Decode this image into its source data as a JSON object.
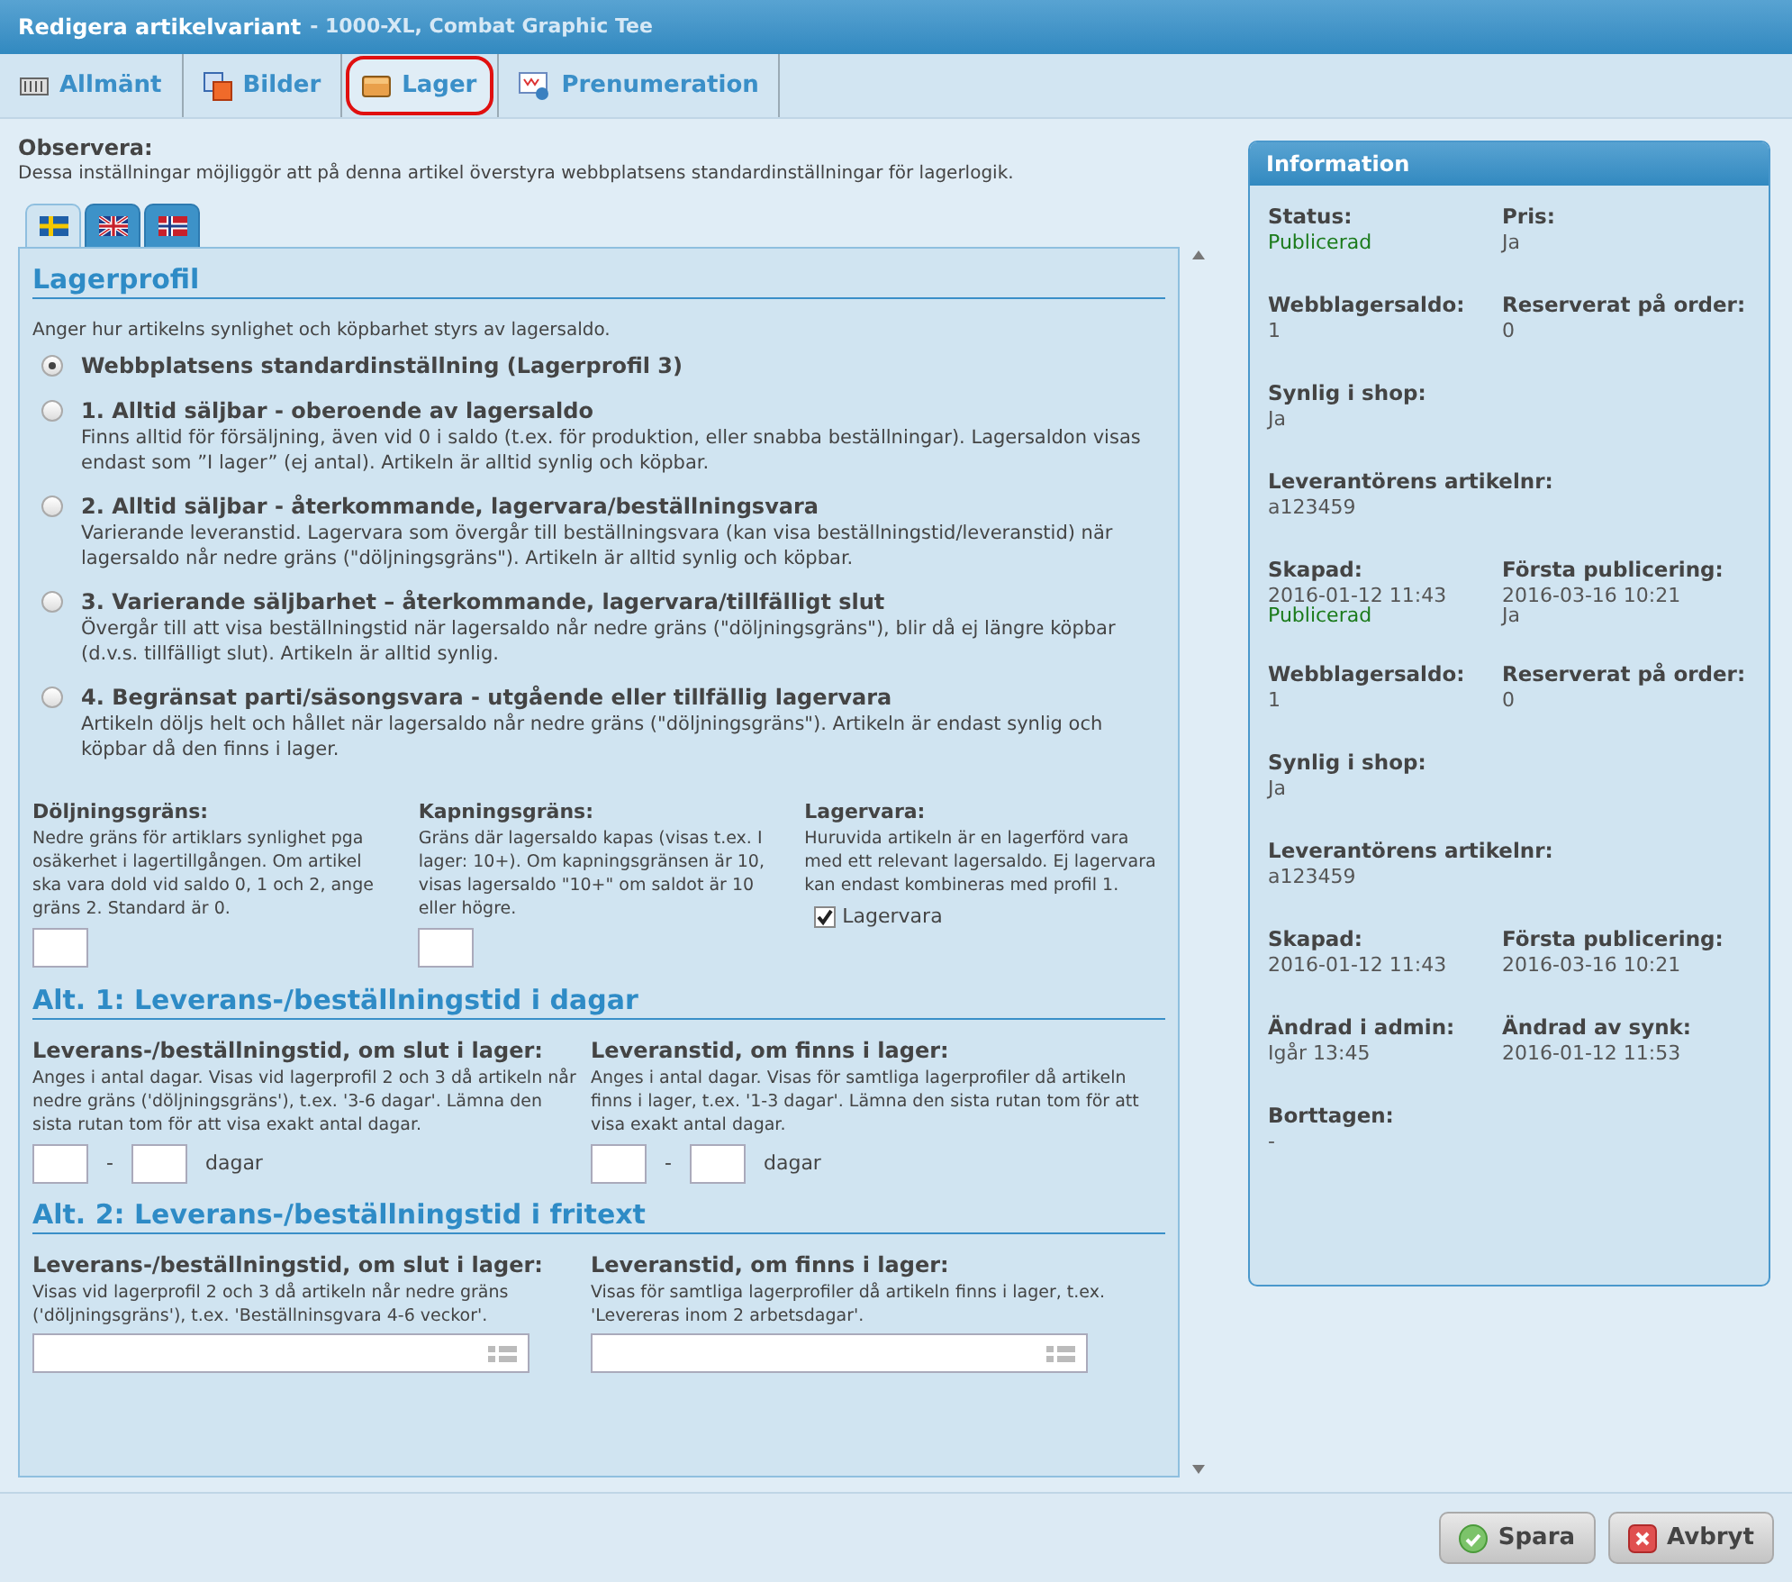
{
  "window": {
    "title": "Redigera artikelvariant",
    "subtitle": "- 1000-XL, Combat Graphic Tee"
  },
  "tabs": [
    {
      "label": "Allmänt",
      "kind": "sliders",
      "selected": false
    },
    {
      "label": "Bilder",
      "kind": "images",
      "selected": false
    },
    {
      "label": "Lager",
      "kind": "box",
      "selected": true
    },
    {
      "label": "Prenumeration",
      "kind": "subscription",
      "selected": false
    }
  ],
  "notice": {
    "title": "Observera:",
    "text": "Dessa inställningar möjliggör att på denna artikel överstyra webbplatsens standardinställningar för lagerlogik."
  },
  "language_tabs": [
    {
      "kind": "sweden",
      "selected": true
    },
    {
      "kind": "uk",
      "selected": false
    },
    {
      "kind": "norway",
      "selected": false
    }
  ],
  "profile": {
    "heading": "Lagerprofil",
    "intro": "Anger hur artikelns synlighet och köpbarhet styrs av lagersaldo.",
    "options": [
      {
        "title": "Webbplatsens standardinställning (Lagerprofil 3)",
        "selected": true
      },
      {
        "title": "1. Alltid säljbar - oberoende av lagersaldo",
        "description": "Finns alltid för försäljning, även vid 0 i saldo (t.ex. för produktion, eller snabba beställningar). Lagersaldon visas endast som ”I lager” (ej antal). Artikeln är alltid synlig och köpbar.",
        "selected": false
      },
      {
        "title": "2. Alltid säljbar - återkommande, lagervara/beställningsvara",
        "description": "Varierande leveranstid. Lagervara som övergår till beställningsvara (kan visa beställningstid/leveranstid) när lagersaldo når nedre gräns (\"döljningsgräns\"). Artikeln är alltid synlig och köpbar.",
        "selected": false
      },
      {
        "title": "3. Varierande säljbarhet – återkommande, lagervara/tillfälligt slut",
        "description": "Övergår till att visa beställningstid när lagersaldo når nedre gräns (\"döljningsgräns\"), blir då ej längre köpbar (d.v.s. tillfälligt slut). Artikeln är alltid synlig.",
        "selected": false
      },
      {
        "title": "4. Begränsat parti/säsongsvara - utgående eller tillfällig lagervara",
        "description": "Artikeln döljs helt och hållet när lagersaldo når nedre gräns (\"döljningsgräns\"). Artikeln är endast synlig och köpbar då den finns i lager.",
        "selected": false
      }
    ]
  },
  "limits": [
    {
      "kind": "input",
      "label": "Döljningsgräns:",
      "text": "Nedre gräns för artiklars synlighet pga osäkerhet i lagertillgången. Om artikel ska vara dold vid saldo 0, 1 och 2, ange gräns 2. Standard är 0."
    },
    {
      "kind": "input",
      "label": "Kapningsgräns:",
      "text": "Gräns där lagersaldo kapas (visas t.ex. I lager: 10+). Om kapningsgränsen är 10, visas lagersaldo \"10+\" om saldot är 10 eller högre."
    },
    {
      "kind": "checkbox",
      "label": "Lagervara:",
      "text": "Huruvida artikeln är en lagerförd vara med ett relevant lagersaldo. Ej lagervara kan endast kombineras med profil 1.",
      "checkbox_label": "Lagervara",
      "checked": true
    }
  ],
  "alt1": {
    "heading": "Alt. 1: Leverans-/beställningstid i dagar",
    "fields": [
      {
        "label": "Leverans-/beställningstid, om slut i lager:",
        "text": "Anges i antal dagar. Visas vid lagerprofil 2 och 3 då artikeln når nedre gräns ('döljningsgräns'), t.ex. '3-6 dagar'. Lämna den sista rutan tom för att visa exakt antal dagar.",
        "separator": "-",
        "unit": "dagar"
      },
      {
        "label": "Leveranstid, om finns i lager:",
        "text": "Anges i antal dagar. Visas för samtliga lagerprofiler då artikeln finns i lager, t.ex. '1-3 dagar'. Lämna den sista rutan tom för att visa exakt antal dagar.",
        "separator": "-",
        "unit": "dagar"
      }
    ]
  },
  "alt2": {
    "heading": "Alt. 2: Leverans-/beställningstid i fritext",
    "fields": [
      {
        "label": "Leverans-/beställningstid, om slut i lager:",
        "text": "Visas vid lagerprofil 2 och 3 då artikeln når nedre gräns ('döljningsgräns'), t.ex. 'Beställninsgvara 4-6 veckor'."
      },
      {
        "label": "Leveranstid, om finns i lager:",
        "text": "Visas för samtliga lagerprofiler då artikeln finns i lager, t.ex. 'Levereras inom 2 arbetsdagar'."
      }
    ]
  },
  "information": {
    "title": "Information",
    "rows": [
      [
        {
          "label": "Status:",
          "value": "Publicerad",
          "color": "#1a7a1a"
        },
        {
          "label": "Pris:",
          "value": "Ja",
          "color": "#555555"
        }
      ],
      [
        {
          "label": "Webblagersaldo:",
          "value": "1",
          "color": "#555555"
        },
        {
          "label": "Reserverat på order:",
          "value": "0",
          "color": "#555555"
        }
      ],
      [
        {
          "label": "Synlig i shop:",
          "value": "Ja",
          "color": "#555555"
        }
      ],
      [
        {
          "label": "Leverantörens artikelnr:",
          "value": "a123459",
          "color": "#555555"
        }
      ],
      [
        {
          "label": "Skapad:",
          "value": "2016-01-12 11:43",
          "color": "#555555",
          "overlay": {
            "text": "Publicerad",
            "color": "#1a7a1a"
          }
        },
        {
          "label": "Första publicering:",
          "value": "2016-03-16 10:21",
          "color": "#555555",
          "overlay": {
            "text": "Ja",
            "color": "#555555"
          }
        }
      ],
      [
        {
          "label": "Webblagersaldo:",
          "value": "1",
          "color": "#555555"
        },
        {
          "label": "Reserverat på order:",
          "value": "0",
          "color": "#555555"
        }
      ],
      [
        {
          "label": "Synlig i shop:",
          "value": "Ja",
          "color": "#555555"
        }
      ],
      [
        {
          "label": "Leverantörens artikelnr:",
          "value": "a123459",
          "color": "#555555"
        }
      ],
      [
        {
          "label": "Skapad:",
          "value": "2016-01-12 11:43",
          "color": "#555555"
        },
        {
          "label": "Första publicering:",
          "value": "2016-03-16 10:21",
          "color": "#555555"
        }
      ],
      [
        {
          "label": "Ändrad i admin:",
          "value": "Igår 13:45",
          "color": "#555555"
        },
        {
          "label": "Ändrad av synk:",
          "value": "2016-01-12 11:53",
          "color": "#555555"
        }
      ],
      [
        {
          "label": "Borttagen:",
          "value": "-",
          "color": "#555555"
        }
      ]
    ]
  },
  "buttons": [
    {
      "label": "Spara",
      "kind": "save"
    },
    {
      "label": "Avbryt",
      "kind": "cancel"
    }
  ]
}
